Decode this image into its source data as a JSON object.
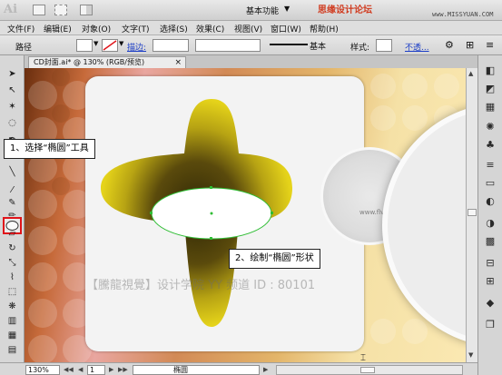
{
  "titlebar": {
    "app_logo": "Ai",
    "workspace": "基本功能",
    "watermark_site": "思缘设计论坛",
    "watermark_url": "www.MISSYUAN.COM",
    "icons": [
      "document-icon",
      "layout-icon",
      "arrange-icon"
    ]
  },
  "menubar": {
    "items": [
      "文件(F)",
      "编辑(E)",
      "对象(O)",
      "文字(T)",
      "选择(S)",
      "效果(C)",
      "视图(V)",
      "窗口(W)",
      "帮助(H)"
    ]
  },
  "controlbar": {
    "label": "路径",
    "stroke_label": "描边:",
    "stroke_line": "基本",
    "style_label": "样式:",
    "opacity_label": "不透..."
  },
  "document": {
    "tab_title": "CD封面.ai* @ 130% (RGB/预览)",
    "close_glyph": "×"
  },
  "canvas": {
    "watermark": "【騰龍視覺】设计学院  YY 频道 ID : 80101",
    "disc_text": "www.flvi.net",
    "colors": {
      "star_dark": "#2e2605",
      "star_mid": "#8f7a12",
      "star_light": "#e5d31a",
      "ellipse_stroke": "#2fbd34",
      "highlight_red": "#e0141a"
    }
  },
  "callouts": {
    "step1": "1、选择“椭圆”工具",
    "step2": "2、绘制“椭圆”形状"
  },
  "statusbar": {
    "zoom": "130%",
    "page": "1",
    "tool_name": "椭圆"
  }
}
